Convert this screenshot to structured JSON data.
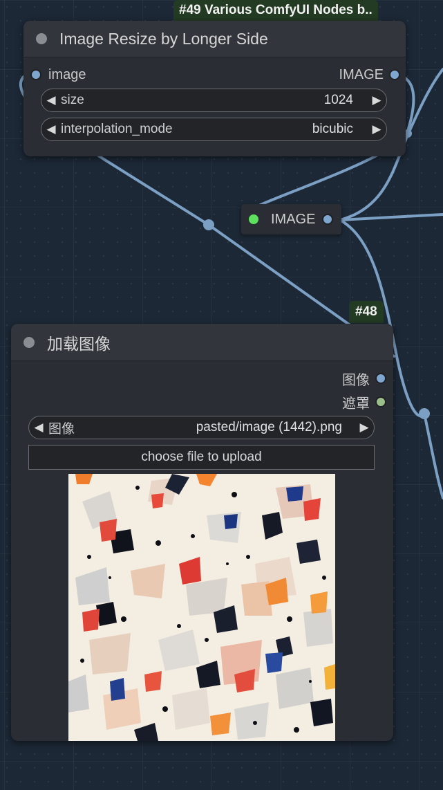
{
  "node49": {
    "badge": "#49 Various ComfyUI Nodes b..",
    "title": "Image Resize by Longer Side",
    "input_label": "image",
    "output_label": "IMAGE",
    "widgets": [
      {
        "label": "size",
        "value": "1024"
      },
      {
        "label": "interpolation_mode",
        "value": "bicubic"
      }
    ]
  },
  "reroute": {
    "label": "IMAGE"
  },
  "node48": {
    "badge": "#48",
    "title": "加载图像",
    "outputs": [
      "图像",
      "遮罩"
    ],
    "widget": {
      "label": "图像",
      "value": "pasted/image (1442).png"
    },
    "upload_label": "choose file to upload"
  },
  "colors": {
    "image_port": "#7fa6cf",
    "mask_port": "#9bbf8a",
    "reroute_status": "#5de05d",
    "link": "#7c9fc4",
    "badge_bg": "#233a23"
  },
  "arrows": {
    "left": "◀",
    "right": "▶"
  }
}
